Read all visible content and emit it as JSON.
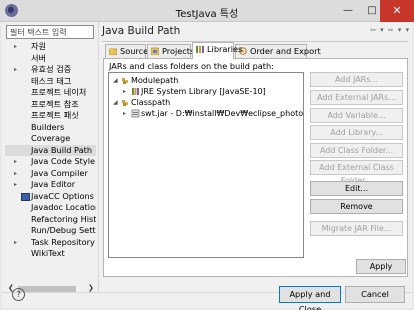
{
  "window": {
    "title": "TestJava 특성"
  },
  "filter": {
    "placeholder": "필터 텍스트 입력"
  },
  "sidebar": {
    "items": [
      {
        "label": "자원",
        "expandable": true
      },
      {
        "label": "서버",
        "expandable": false
      },
      {
        "label": "유효성 검증",
        "expandable": true
      },
      {
        "label": "태스크 태그",
        "expandable": false
      },
      {
        "label": "프로젝트 네이처",
        "expandable": false
      },
      {
        "label": "프로젝트 참조",
        "expandable": false
      },
      {
        "label": "프로젝트 패싯",
        "expandable": false
      },
      {
        "label": "Builders",
        "expandable": false
      },
      {
        "label": "Coverage",
        "expandable": false
      },
      {
        "label": "Java Build Path",
        "expandable": false,
        "selected": true
      },
      {
        "label": "Java Code Style",
        "expandable": true
      },
      {
        "label": "Java Compiler",
        "expandable": true
      },
      {
        "label": "Java Editor",
        "expandable": true
      },
      {
        "label": "JavaCC Options",
        "expandable": false,
        "icon": "javacc-icon"
      },
      {
        "label": "Javadoc Location",
        "expandable": false
      },
      {
        "label": "Refactoring History",
        "expandable": false
      },
      {
        "label": "Run/Debug Settings",
        "expandable": false
      },
      {
        "label": "Task Repository",
        "expandable": true
      },
      {
        "label": "WikiText",
        "expandable": false
      }
    ]
  },
  "page": {
    "title": "Java Build Path"
  },
  "tabs": [
    {
      "label": "Source",
      "icon": "source-folder-icon",
      "active": false
    },
    {
      "label": "Projects",
      "icon": "projects-icon",
      "active": false
    },
    {
      "label": "Libraries",
      "icon": "libraries-icon",
      "active": true
    },
    {
      "label": "Order and Export",
      "icon": "order-export-icon",
      "active": false
    }
  ],
  "libraries": {
    "description": "JARs and class folders on the build path:",
    "tree": [
      {
        "label": "Modulepath",
        "depth": 0,
        "expanded": true,
        "icon": "modulepath-icon"
      },
      {
        "label": "JRE System Library [JavaSE-10]",
        "depth": 1,
        "expanded": false,
        "icon": "library-icon"
      },
      {
        "label": "Classpath",
        "depth": 0,
        "expanded": true,
        "icon": "classpath-icon"
      },
      {
        "label": "swt.jar - D:₩install₩Dev₩eclipse_photon₩lib₩sw",
        "depth": 1,
        "expanded": false,
        "icon": "jar-icon"
      }
    ],
    "buttons": [
      {
        "label": "Add JARs...",
        "enabled": false
      },
      {
        "label": "Add External JARs...",
        "enabled": false
      },
      {
        "label": "Add Variable...",
        "enabled": false
      },
      {
        "label": "Add Library...",
        "enabled": false
      },
      {
        "label": "Add Class Folder...",
        "enabled": false
      },
      {
        "label": "Add External Class Folder...",
        "enabled": false
      },
      {
        "label": "Edit...",
        "enabled": true
      },
      {
        "label": "Remove",
        "enabled": true
      },
      {
        "label": "Migrate JAR File...",
        "enabled": false
      }
    ]
  },
  "footer": {
    "apply_label": "Apply",
    "apply_close_label": "Apply and Close",
    "cancel_label": "Cancel",
    "help_glyph": "?"
  }
}
